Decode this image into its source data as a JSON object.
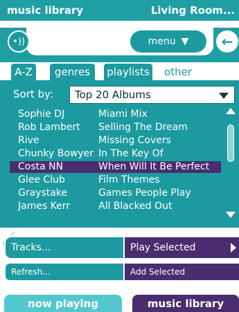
{
  "header": {
    "title": "music library",
    "zone": "Living Room..."
  },
  "toolbar": {
    "volume_icon": "volume-icon",
    "menu_label": "menu",
    "back_icon": "back-arrow-icon"
  },
  "tabs": [
    {
      "label": "A-Z",
      "active": false
    },
    {
      "label": "genres",
      "active": false
    },
    {
      "label": "playlists",
      "active": false
    },
    {
      "label": "other",
      "active": true
    }
  ],
  "sort": {
    "label": "Sort by:",
    "value": "Top 20 Albums"
  },
  "list": {
    "rows": [
      {
        "artist": "Sophie DJ",
        "album": "Miami Mix"
      },
      {
        "artist": "Rob Lambert",
        "album": "Selling The Dream"
      },
      {
        "artist": "Rive",
        "album": "Missing Covers"
      },
      {
        "artist": "Chunky Bowyer",
        "album": "In The Key Of"
      },
      {
        "artist": "Costa NN",
        "album": "When Will It Be Perfect",
        "selected": true
      },
      {
        "artist": "Glee Club",
        "album": "Film Themes"
      },
      {
        "artist": "Graystake",
        "album": "Games People Play"
      },
      {
        "artist": "James Kerr",
        "album": "All Blacked Out"
      }
    ]
  },
  "actions": {
    "tracks": "Tracks...",
    "play_selected": "Play Selected",
    "refresh": "Refresh...",
    "add_selected": "Add Selected"
  },
  "bottom_nav": {
    "now_playing": "now playing",
    "music_library": "music library"
  },
  "colors": {
    "teal": "#1c9aa0",
    "purple": "#4a2d6e",
    "light_teal": "#52c7cd"
  }
}
